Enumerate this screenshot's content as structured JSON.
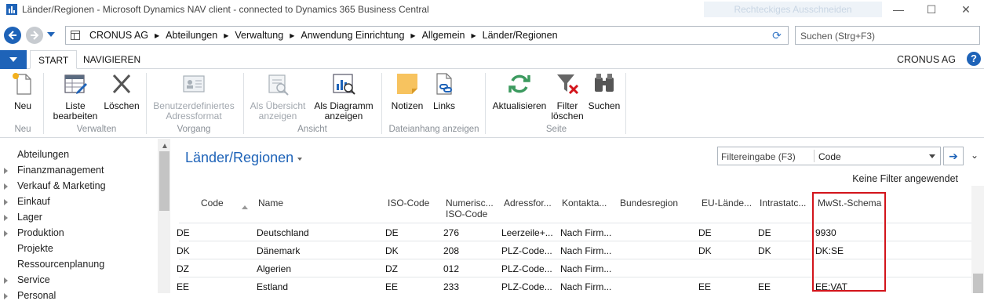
{
  "window": {
    "title": "Länder/Regionen - Microsoft Dynamics NAV client - connected to Dynamics 365 Business Central",
    "ghost_label": "Rechteckiges Ausschneiden"
  },
  "address": {
    "breadcrumb": [
      "CRONUS AG",
      "Abteilungen",
      "Verwaltung",
      "Anwendung Einrichtung",
      "Allgemein",
      "Länder/Regionen"
    ],
    "search_placeholder": "Suchen (Strg+F3)"
  },
  "tabs": {
    "start": "START",
    "navigate": "NAVIGIEREN",
    "company": "CRONUS AG"
  },
  "ribbon": {
    "new": "Neu",
    "edit_list": "Liste bearbeiten",
    "delete": "Löschen",
    "custom_address": "Benutzerdefiniertes Adressformat",
    "as_overview": "Als Übersicht anzeigen",
    "as_chart": "Als Diagramm anzeigen",
    "notes": "Notizen",
    "links": "Links",
    "refresh": "Aktualisieren",
    "clear_filter": "Filter löschen",
    "find": "Suchen",
    "groups": {
      "new": "Neu",
      "manage": "Verwalten",
      "process": "Vorgang",
      "view": "Ansicht",
      "attachments": "Dateianhang anzeigen",
      "page": "Seite"
    }
  },
  "nav": {
    "items": [
      "Abteilungen",
      "Finanzmanagement",
      "Verkauf & Marketing",
      "Einkauf",
      "Lager",
      "Produktion",
      "Projekte",
      "Ressourcenplanung",
      "Service",
      "Personal"
    ]
  },
  "main": {
    "title": "Länder/Regionen",
    "filter_label": "Filtereingabe (F3)",
    "filter_field": "Code",
    "no_filter": "Keine Filter angewendet",
    "columns": {
      "code": "Code",
      "name": "Name",
      "iso": "ISO-Code",
      "numeric_line1": "Numerisc...",
      "numeric_line2": "ISO-Code",
      "address": "Adressfor...",
      "contact": "Kontakta...",
      "state": "Bundesregion",
      "eu": "EU-Lände...",
      "intrastat": "Intrastatc...",
      "vat": "MwSt.-Schema"
    },
    "rows": [
      {
        "code": "DE",
        "name": "Deutschland",
        "iso": "DE",
        "num": "276",
        "addr": "Leerzeile+...",
        "contact": "Nach Firm...",
        "state": "",
        "eu": "DE",
        "intrastat": "DE",
        "vat": "9930"
      },
      {
        "code": "DK",
        "name": "Dänemark",
        "iso": "DK",
        "num": "208",
        "addr": "PLZ-Code...",
        "contact": "Nach Firm...",
        "state": "",
        "eu": "DK",
        "intrastat": "DK",
        "vat": "DK:SE"
      },
      {
        "code": "DZ",
        "name": "Algerien",
        "iso": "DZ",
        "num": "012",
        "addr": "PLZ-Code...",
        "contact": "Nach Firm...",
        "state": "",
        "eu": "",
        "intrastat": "",
        "vat": ""
      },
      {
        "code": "EE",
        "name": "Estland",
        "iso": "EE",
        "num": "233",
        "addr": "PLZ-Code...",
        "contact": "Nach Firm...",
        "state": "",
        "eu": "EE",
        "intrastat": "EE",
        "vat": "EE:VAT"
      }
    ]
  }
}
